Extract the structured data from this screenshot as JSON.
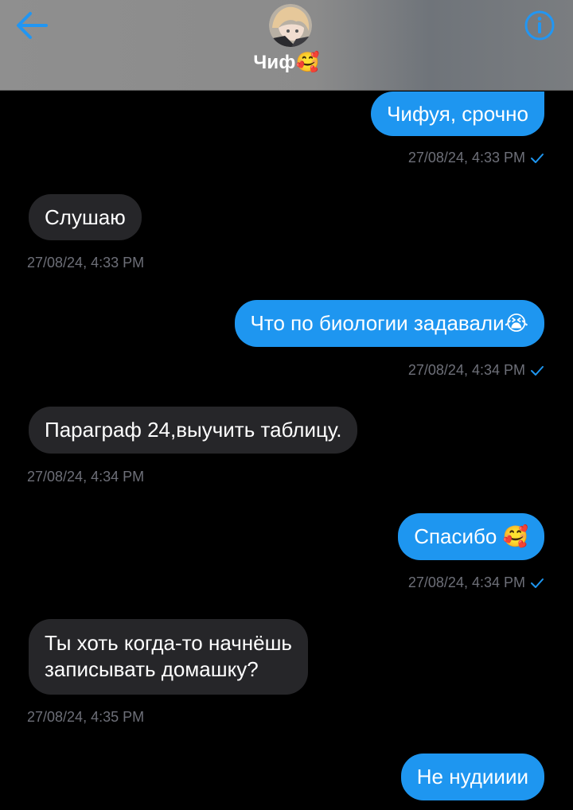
{
  "header": {
    "contact_name": "Чиф🥰",
    "back_icon": "arrow-left-icon",
    "info_icon": "info-circle-icon",
    "accent_color": "#2196f3"
  },
  "messages": [
    {
      "direction": "out",
      "text": "Чифуя, срочно",
      "timestamp": "27/08/24, 4:33 PM",
      "read": true
    },
    {
      "direction": "in",
      "text": "Слушаю",
      "timestamp": "27/08/24, 4:33 PM"
    },
    {
      "direction": "out",
      "text": "Что по биологии задавали😭",
      "timestamp": "27/08/24, 4:34 PM",
      "read": true
    },
    {
      "direction": "in",
      "text": "Параграф 24,выучить таблицу.",
      "timestamp": "27/08/24, 4:34 PM"
    },
    {
      "direction": "out",
      "text": "Спасибо 🥰",
      "timestamp": "27/08/24, 4:34 PM",
      "read": true
    },
    {
      "direction": "in",
      "text_lines": [
        "Ты хоть  когда-то начнёшь",
        "записывать домашку?"
      ],
      "timestamp": "27/08/24, 4:35 PM"
    },
    {
      "direction": "out",
      "text": "Не нудииии"
    }
  ],
  "colors": {
    "outgoing_bubble": "#1e96f0",
    "incoming_bubble": "#262629",
    "timestamp": "#6d6f78",
    "read_check": "#1e96f0"
  }
}
